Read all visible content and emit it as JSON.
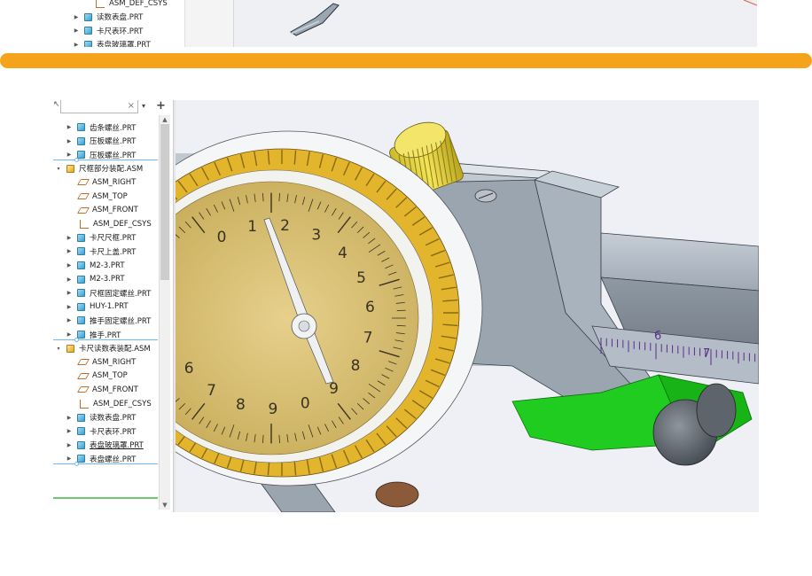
{
  "top_panel": {
    "items": [
      {
        "label": "ASM_DEF_CSYS",
        "kind": "csys"
      },
      {
        "label": "读数表盘.PRT",
        "kind": "part"
      },
      {
        "label": "卡尺表环.PRT",
        "kind": "part"
      },
      {
        "label": "表盘玻璃罩.PRT",
        "kind": "part"
      }
    ]
  },
  "divider_color": "#f5a31a",
  "model_tree": {
    "search_clear": "×",
    "dropdown_glyph": "▾",
    "add_glyph": "+",
    "items": [
      {
        "label": "齿条螺丝.PRT",
        "kind": "part",
        "indent": 1
      },
      {
        "label": "压板螺丝.PRT",
        "kind": "part",
        "indent": 1
      },
      {
        "label": "压板螺丝.PRT",
        "kind": "part",
        "indent": 1
      },
      {
        "label": "尺框部分装配.ASM",
        "kind": "asm",
        "indent": 0
      },
      {
        "label": "ASM_RIGHT",
        "kind": "plane",
        "indent": 1
      },
      {
        "label": "ASM_TOP",
        "kind": "plane",
        "indent": 1
      },
      {
        "label": "ASM_FRONT",
        "kind": "plane",
        "indent": 1
      },
      {
        "label": "ASM_DEF_CSYS",
        "kind": "csys",
        "indent": 1
      },
      {
        "label": "卡尺尺框.PRT",
        "kind": "part",
        "indent": 1
      },
      {
        "label": "卡尺上盖.PRT",
        "kind": "part",
        "indent": 1
      },
      {
        "label": "M2-3.PRT",
        "kind": "part",
        "indent": 1
      },
      {
        "label": "M2-3.PRT",
        "kind": "part",
        "indent": 1
      },
      {
        "label": "尺框固定螺丝.PRT",
        "kind": "part",
        "indent": 1
      },
      {
        "label": "HUY-1.PRT",
        "kind": "part",
        "indent": 1
      },
      {
        "label": "推手固定螺丝.PRT",
        "kind": "part",
        "indent": 1
      },
      {
        "label": "推手.PRT",
        "kind": "part",
        "indent": 1
      },
      {
        "label": "卡尺读数表装配.ASM",
        "kind": "asm",
        "indent": 0
      },
      {
        "label": "ASM_RIGHT",
        "kind": "plane",
        "indent": 1
      },
      {
        "label": "ASM_TOP",
        "kind": "plane",
        "indent": 1
      },
      {
        "label": "ASM_FRONT",
        "kind": "plane",
        "indent": 1
      },
      {
        "label": "ASM_DEF_CSYS",
        "kind": "csys",
        "indent": 1
      },
      {
        "label": "读数表盘.PRT",
        "kind": "part",
        "indent": 1
      },
      {
        "label": "卡尺表环.PRT",
        "kind": "part",
        "indent": 1
      },
      {
        "label": "表盘玻璃罩.PRT",
        "kind": "part",
        "indent": 1,
        "underlined": true
      },
      {
        "label": "表盘螺丝.PRT",
        "kind": "part",
        "indent": 1
      }
    ]
  },
  "dial": {
    "numbers": [
      "0",
      "1",
      "2",
      "3",
      "4",
      "5",
      "6",
      "7",
      "8",
      "9",
      "0",
      "9",
      "8",
      "7",
      "6"
    ]
  },
  "scale": {
    "labels": [
      "6",
      "7"
    ]
  },
  "colors": {
    "dial_face": "#d9c27a",
    "bezel": "#e2b52c",
    "knob": "#f0e050",
    "pusher": "#1fcc1f",
    "body": "#a3aeb9"
  }
}
